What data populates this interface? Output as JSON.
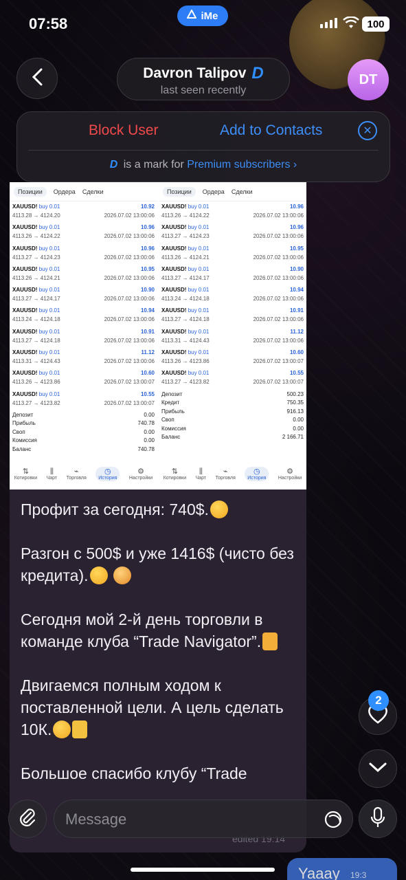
{
  "status": {
    "time": "07:58",
    "app_pill": "iMe",
    "battery": "100"
  },
  "header": {
    "contact_name": "Davron Talipov",
    "premium_mark": "D",
    "last_seen": "last seen recently",
    "avatar_initials": "DT"
  },
  "action_panel": {
    "block_label": "Block User",
    "add_label": "Add to Contacts",
    "premium_mark": "D",
    "premium_text": "is a mark for",
    "premium_link": "Premium subscribers ›"
  },
  "screenshots": [
    {
      "tabs": [
        "Позиции",
        "Ордера",
        "Сделки"
      ],
      "trades": [
        {
          "symbol": "XAUUSD!",
          "side": "buy 0.01",
          "prices": "4113.28 → 4124.20",
          "date": "2026.07.02 13:00:06",
          "profit": "10.92"
        },
        {
          "symbol": "XAUUSD!",
          "side": "buy 0.01",
          "prices": "4113.26 → 4124.22",
          "date": "2026.07.02 13:00:06",
          "profit": "10.96"
        },
        {
          "symbol": "XAUUSD!",
          "side": "buy 0.01",
          "prices": "4113.27 → 4124.23",
          "date": "2026.07.02 13:00:06",
          "profit": "10.96"
        },
        {
          "symbol": "XAUUSD!",
          "side": "buy 0.01",
          "prices": "4113.26 → 4124.21",
          "date": "2026.07.02 13:00:06",
          "profit": "10.95"
        },
        {
          "symbol": "XAUUSD!",
          "side": "buy 0.01",
          "prices": "4113.27 → 4124.17",
          "date": "2026.07.02 13:00:06",
          "profit": "10.90"
        },
        {
          "symbol": "XAUUSD!",
          "side": "buy 0.01",
          "prices": "4113.24 → 4124.18",
          "date": "2026.07.02 13:00:06",
          "profit": "10.94"
        },
        {
          "symbol": "XAUUSD!",
          "side": "buy 0.01",
          "prices": "4113.27 → 4124.18",
          "date": "2026.07.02 13:00:06",
          "profit": "10.91"
        },
        {
          "symbol": "XAUUSD!",
          "side": "buy 0.01",
          "prices": "4113.31 → 4124.43",
          "date": "2026.07.02 13:00:06",
          "profit": "11.12"
        },
        {
          "symbol": "XAUUSD!",
          "side": "buy 0.01",
          "prices": "4113.26 → 4123.86",
          "date": "2026.07.02 13:00:07",
          "profit": "10.60"
        },
        {
          "symbol": "XAUUSD!",
          "side": "buy 0.01",
          "prices": "4113.27 → 4123.82",
          "date": "2026.07.02 13:00:07",
          "profit": "10.55"
        }
      ],
      "summary": [
        {
          "label": "Депозит",
          "value": "0.00"
        },
        {
          "label": "Прибыль",
          "value": "740.78"
        },
        {
          "label": "Своп",
          "value": "0.00"
        },
        {
          "label": "Комиссия",
          "value": "0.00"
        },
        {
          "label": "Баланс",
          "value": "740.78"
        }
      ],
      "nav": [
        "Котировки",
        "Чарт",
        "Торговля",
        "История",
        "Настройки"
      ]
    },
    {
      "tabs": [
        "Позиции",
        "Ордера",
        "Сделки"
      ],
      "trades": [
        {
          "symbol": "XAUUSD!",
          "side": "buy 0.01",
          "prices": "4113.26 → 4124.22",
          "date": "2026.07.02 13:00:06",
          "profit": "10.96"
        },
        {
          "symbol": "XAUUSD!",
          "side": "buy 0.01",
          "prices": "4113.27 → 4124.23",
          "date": "2026.07.02 13:00:06",
          "profit": "10.96"
        },
        {
          "symbol": "XAUUSD!",
          "side": "buy 0.01",
          "prices": "4113.26 → 4124.21",
          "date": "2026.07.02 13:00:06",
          "profit": "10.95"
        },
        {
          "symbol": "XAUUSD!",
          "side": "buy 0.01",
          "prices": "4113.27 → 4124.17",
          "date": "2026.07.02 13:00:06",
          "profit": "10.90"
        },
        {
          "symbol": "XAUUSD!",
          "side": "buy 0.01",
          "prices": "4113.24 → 4124.18",
          "date": "2026.07.02 13:00:06",
          "profit": "10.94"
        },
        {
          "symbol": "XAUUSD!",
          "side": "buy 0.01",
          "prices": "4113.27 → 4124.18",
          "date": "2026.07.02 13:00:06",
          "profit": "10.91"
        },
        {
          "symbol": "XAUUSD!",
          "side": "buy 0.01",
          "prices": "4113.31 → 4124.43",
          "date": "2026.07.02 13:00:06",
          "profit": "11.12"
        },
        {
          "symbol": "XAUUSD!",
          "side": "buy 0.01",
          "prices": "4113.26 → 4123.86",
          "date": "2026.07.02 13:00:07",
          "profit": "10.60"
        },
        {
          "symbol": "XAUUSD!",
          "side": "buy 0.01",
          "prices": "4113.27 → 4123.82",
          "date": "2026.07.02 13:00:07",
          "profit": "10.55"
        }
      ],
      "summary": [
        {
          "label": "Депозит",
          "value": "500.23"
        },
        {
          "label": "Кредит",
          "value": "750.35"
        },
        {
          "label": "Прибыль",
          "value": "916.13"
        },
        {
          "label": "Своп",
          "value": "0.00"
        },
        {
          "label": "Комиссия",
          "value": "0.00"
        },
        {
          "label": "Баланс",
          "value": "2 166.71"
        }
      ],
      "nav": [
        "Котировки",
        "Чарт",
        "Торговля",
        "История",
        "Настройки"
      ]
    }
  ],
  "message": {
    "p1": "Профит за сегодня: 740$.",
    "p2": "Разгон с 500$ и уже 1416$ (чисто без кредита).",
    "p3": "Сегодня мой 2-й день торговли в команде клуба “Trade Navigator”.",
    "p4": "Двигаемся полным ходом к поставленной цели. А цель сделать 10К.",
    "p5": "Большое спасибо клубу “Trade",
    "edited": "edited 19:14"
  },
  "reactions": {
    "count": "2"
  },
  "input": {
    "placeholder": "Message"
  },
  "outgoing": {
    "text": "Yaaay",
    "time": "19:3"
  }
}
